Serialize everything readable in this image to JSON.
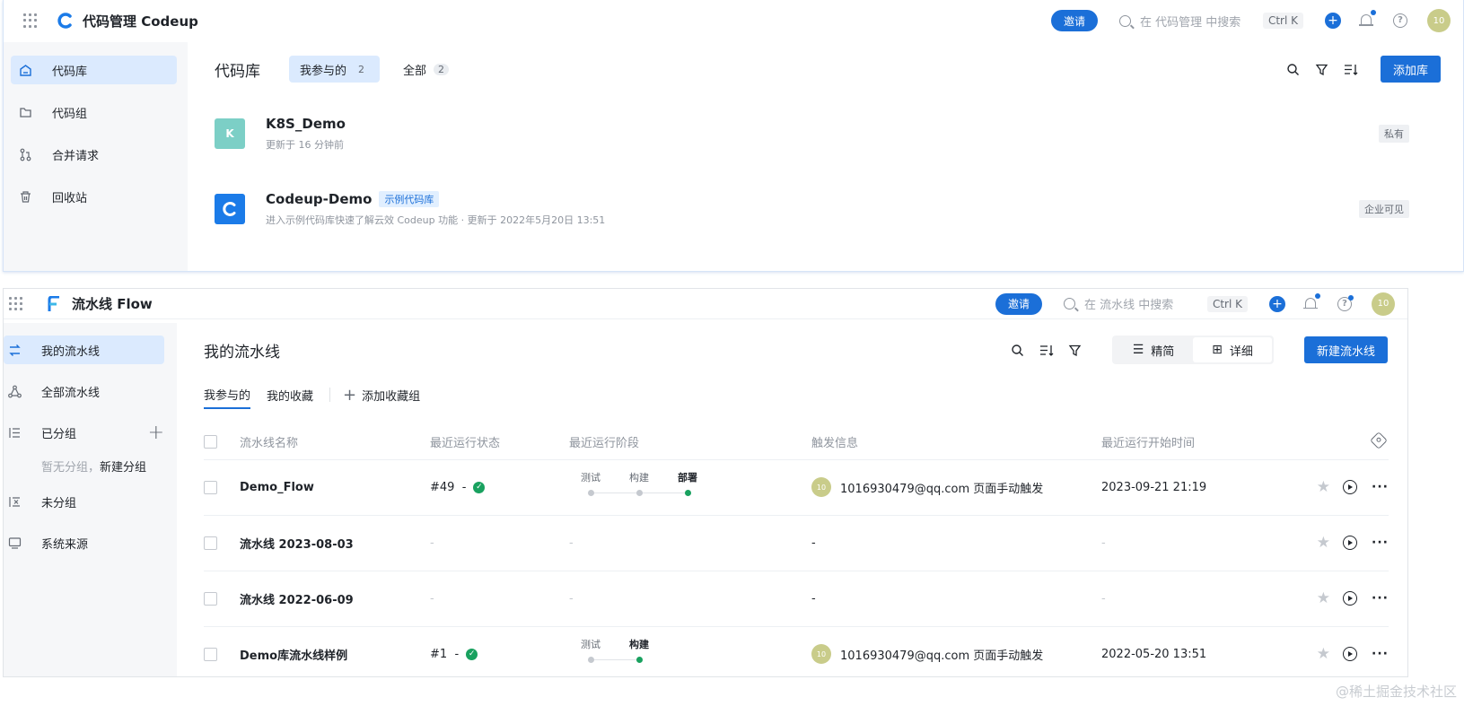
{
  "codeup": {
    "app_title": "代码管理 Codeup",
    "invite": "邀请",
    "search_placeholder": "在 代码管理 中搜索",
    "shortcut": "Ctrl K",
    "avatar": "10",
    "sidebar": [
      {
        "label": "代码库",
        "icon": "repo-icon"
      },
      {
        "label": "代码组",
        "icon": "folder-icon"
      },
      {
        "label": "合并请求",
        "icon": "merge-icon"
      },
      {
        "label": "回收站",
        "icon": "trash-icon"
      }
    ],
    "page_title": "代码库",
    "tabs": [
      {
        "label": "我参与的",
        "count": "2"
      },
      {
        "label": "全部",
        "count": "2"
      }
    ],
    "add_button": "添加库",
    "repos": [
      {
        "initial": "K",
        "name": "K8S_Demo",
        "tag": "",
        "meta": "更新于 16 分钟前",
        "visibility": "私有",
        "color": "#7ccfc6"
      },
      {
        "initial": "C",
        "name": "Codeup-Demo",
        "tag": "示例代码库",
        "meta": "进入示例代码库快速了解云效 Codeup 功能 · 更新于 2022年5月20日 13:51",
        "visibility": "企业可见",
        "color": "#1b7be8"
      }
    ]
  },
  "flow": {
    "app_title": "流水线 Flow",
    "invite": "邀请",
    "search_placeholder": "在 流水线 中搜索",
    "shortcut": "Ctrl K",
    "avatar": "10",
    "sidebar": {
      "my": "我的流水线",
      "all": "全部流水线",
      "grouped": "已分组",
      "no_group_hint": "暂无分组，",
      "new_group": "新建分组",
      "ungrouped": "未分组",
      "source": "系统来源"
    },
    "page_title": "我的流水线",
    "view_compact": "精简",
    "view_detail": "详细",
    "new_button": "新建流水线",
    "tabs": {
      "mine": "我参与的",
      "fav": "我的收藏",
      "add_group": "添加收藏组"
    },
    "columns": [
      "流水线名称",
      "最近运行状态",
      "最近运行阶段",
      "触发信息",
      "最近运行开始时间"
    ],
    "rows": [
      {
        "name": "Demo_Flow",
        "run": "#49",
        "sep": "-",
        "stages": [
          "测试",
          "构建",
          "部署"
        ],
        "trigger": "1016930479@qq.com 页面手动触发",
        "avatar": "10",
        "time": "2023-09-21 21:19"
      },
      {
        "name": "流水线 2023-08-03",
        "run": "-",
        "sep": "",
        "stages": [],
        "trigger": "-",
        "avatar": "",
        "time": "-"
      },
      {
        "name": "流水线 2022-06-09",
        "run": "-",
        "sep": "",
        "stages": [],
        "trigger": "-",
        "avatar": "",
        "time": "-"
      },
      {
        "name": "Demo库流水线样例",
        "run": "#1",
        "sep": "-",
        "stages": [
          "测试",
          "构建"
        ],
        "trigger": "1016930479@qq.com 页面手动触发",
        "avatar": "10",
        "time": "2022-05-20 13:51"
      }
    ]
  },
  "watermark": "@稀土掘金技术社区"
}
